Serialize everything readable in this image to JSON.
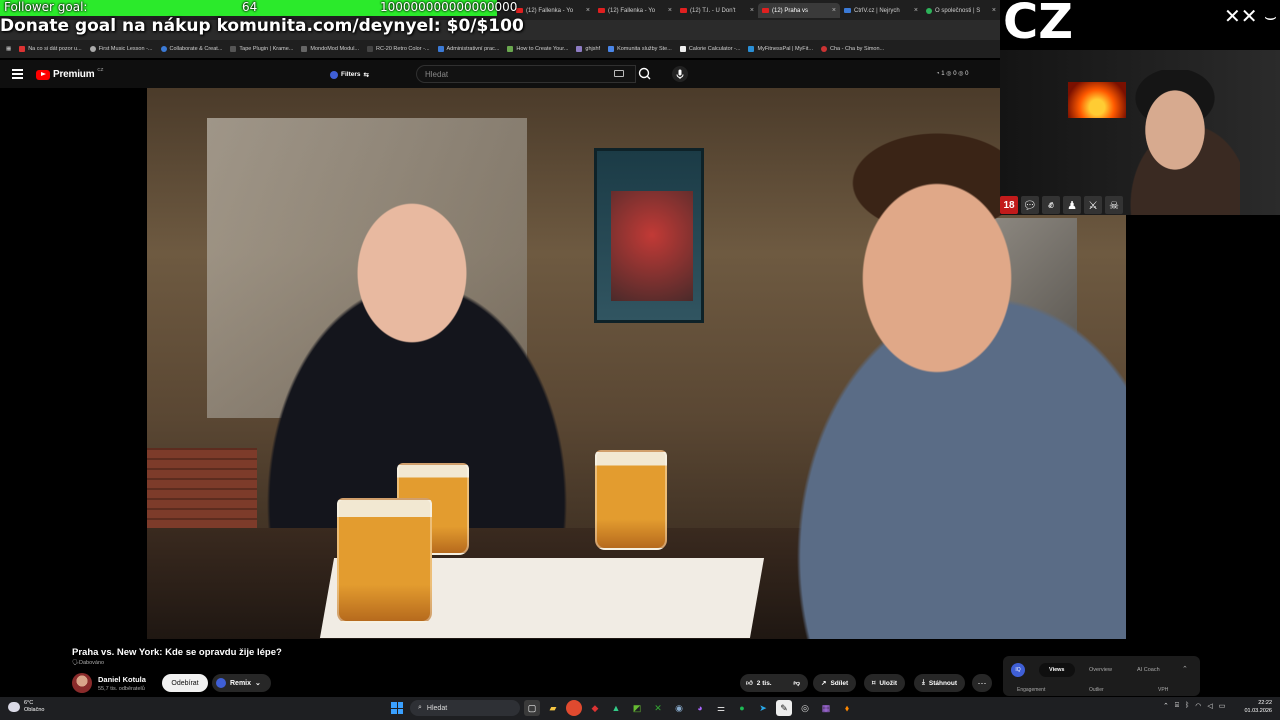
{
  "overlay": {
    "follower_label": "Follower goal:",
    "follower_count": "64",
    "follower_target": "100000000000000000",
    "donate_text": "Donate goal na nákup komunita.com/deynyel: $0/$100",
    "cz_label": "CZ",
    "signature": "✕✕ ⌣"
  },
  "browser": {
    "tabs": [
      {
        "label": "(12) Fallenka - Yo"
      },
      {
        "label": "(12) Fallenka - Yo"
      },
      {
        "label": "(12) T.I. - U Don't"
      },
      {
        "label": "(12) Praha vs"
      },
      {
        "label": "CtrlV.cz | Nejrych"
      },
      {
        "label": "O společnosti | S"
      }
    ],
    "bookmarks": [
      "Na co si dát pozor u...",
      "First Music Lesson -...",
      "Collaborate & Creat...",
      "Tape Plugin | Krame...",
      "MondoMod Modul...",
      "RC-20 Retro Color -...",
      "Administrativní prac...",
      "How to Create Your...",
      "ghjshf",
      "Komunita služby Ste...",
      "Calorie Calculator -...",
      "MyFitnessPal | MyFit...",
      "Cha - Cha by Simon..."
    ]
  },
  "youtube": {
    "brand": "Premium",
    "country": "CZ",
    "filters_label": "Filters",
    "search_placeholder": "Hledat",
    "header_stats": "◔ 1  ◎ 0  ◎ 0",
    "video_title": "Praha vs. New York: Kde se opravdu žije lépe?",
    "dubbed_label": "Dabováno",
    "channel_name": "Daniel Kotula",
    "subscribers": "55,7 tis. odběratelů",
    "subscribe_label": "Odebírat",
    "remix_label": "Remix",
    "likes": "2 tis.",
    "share_label": "Sdílet",
    "save_label": "Uložit",
    "download_label": "Stáhnout"
  },
  "panel": {
    "logo": "IQ",
    "tabs": [
      "Views",
      "Overview",
      "AI Coach"
    ],
    "columns": [
      "Engagement",
      "Outlier",
      "VPH"
    ]
  },
  "stream": {
    "age_badge": "18"
  },
  "taskbar": {
    "temperature": "6°C",
    "weather": "Oblačno",
    "search_label": "Hledat",
    "time": "22:22",
    "date": "01.03.2026"
  },
  "colors": {
    "follower_bar": "#2bea2b",
    "youtube_red": "#ff0000",
    "accent_blue": "#3f5fd6"
  }
}
